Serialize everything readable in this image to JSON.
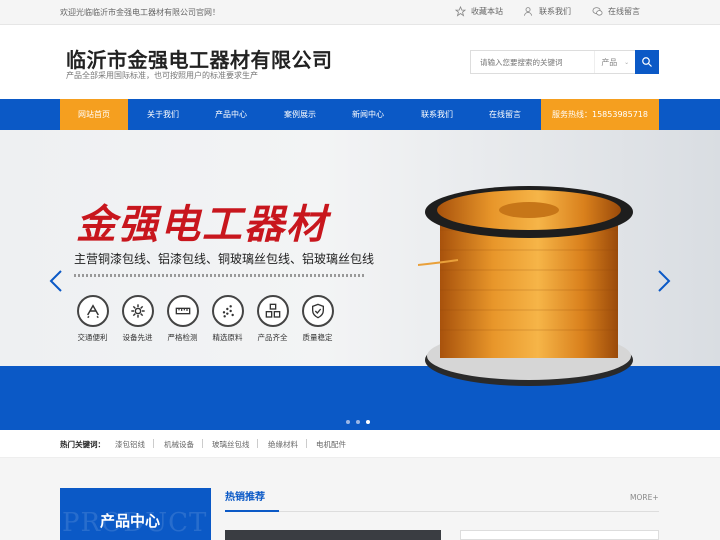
{
  "topbar": {
    "welcome": "欢迎光临临沂市金强电工器材有限公司官网！",
    "favorite": "收藏本站",
    "contact": "联系我们",
    "message": "在线留言"
  },
  "header": {
    "company": "临沂市金强电工器材有限公司",
    "slogan": "产品全部采用国际标准，也可按照用户的标准要求生产",
    "search_placeholder": "请输入您要搜索的关键词",
    "search_scope": "产品"
  },
  "nav": {
    "items": [
      "网站首页",
      "关于我们",
      "产品中心",
      "案例展示",
      "新闻中心",
      "联系我们",
      "在线留言"
    ],
    "active_index": 0,
    "hotline": "服务热线：15853985718"
  },
  "banner": {
    "headline": "金强电工器材",
    "subline": "主营铜漆包线、铝漆包线、铜玻璃丝包线、铝玻璃丝包线",
    "features": [
      {
        "label": "交通便利",
        "icon": "transport-icon"
      },
      {
        "label": "设备先进",
        "icon": "gear-icon"
      },
      {
        "label": "严格检测",
        "icon": "ruler-icon"
      },
      {
        "label": "精选原料",
        "icon": "dots-icon"
      },
      {
        "label": "产品齐全",
        "icon": "grid-icon"
      },
      {
        "label": "质量稳定",
        "icon": "shield-check-icon"
      }
    ],
    "slides_total": 3,
    "slide_active": 3
  },
  "hotwords": {
    "label": "热门关键词：",
    "items": [
      "漆包铝线",
      "机械设备",
      "玻璃丝包线",
      "绝缘材料",
      "电机配件"
    ]
  },
  "sections": {
    "product_center": "产品中心",
    "product_center_bg": "PRODUCT",
    "hot_recommend": "热销推荐",
    "more": "MORE+"
  },
  "colors": {
    "primary": "#0b59c6",
    "accent": "#f59f1f",
    "headline": "#c8161d"
  }
}
